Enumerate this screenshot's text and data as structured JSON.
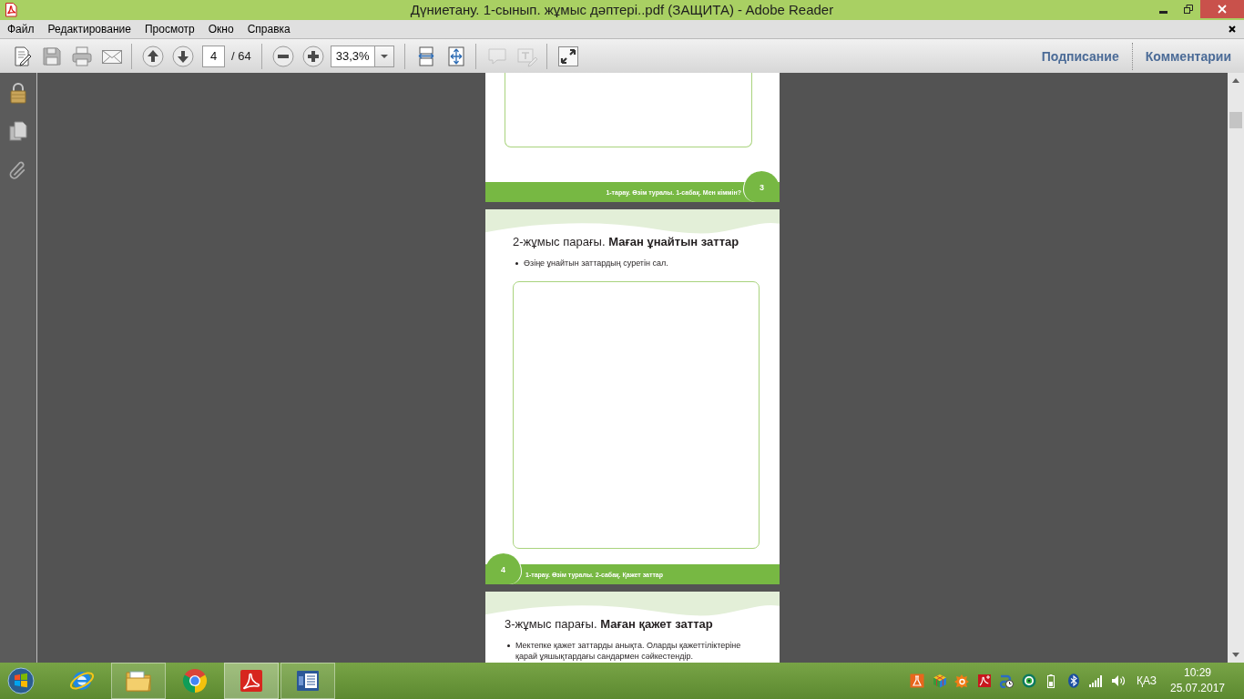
{
  "window": {
    "title": "Дүниетану. 1-сынып. жұмыс дәптері..pdf (ЗАЩИТА) - Adobe Reader"
  },
  "menu": [
    {
      "label": "Файл"
    },
    {
      "label": "Редактирование"
    },
    {
      "label": "Просмотр"
    },
    {
      "label": "Окно"
    },
    {
      "label": "Справка"
    }
  ],
  "toolbar": {
    "file_tools": [
      {
        "kind": "edit",
        "disabled": false
      },
      {
        "kind": "save",
        "disabled": false
      },
      {
        "kind": "print",
        "disabled": false
      },
      {
        "kind": "mail",
        "disabled": false
      }
    ],
    "navigation": {
      "tools": [
        {
          "kind": "previous",
          "disabled": false
        },
        {
          "kind": "next",
          "disabled": false
        }
      ],
      "page_field": {
        "value": "4"
      },
      "page_count": "/ 64"
    },
    "zoom": {
      "tools": [
        {
          "kind": "zoom_out",
          "disabled": false
        },
        {
          "kind": "zoom_in",
          "disabled": false
        }
      ],
      "field": {
        "value": "33,3%"
      }
    },
    "view_tools": [
      {
        "kind": "scroll_mode",
        "disabled": false
      },
      {
        "kind": "fit_page",
        "disabled": false
      }
    ],
    "annotation_tools": [
      {
        "kind": "comment",
        "disabled": true
      },
      {
        "kind": "text",
        "disabled": true
      }
    ],
    "display_tools": [
      {
        "kind": "full_screen",
        "disabled": false
      }
    ],
    "panels": [
      {
        "label": "Подписание"
      },
      {
        "label": "Комментарии"
      }
    ]
  },
  "document": {
    "pages": [
      {
        "kind": "recto",
        "frame": true,
        "footer": {
          "text": "1-тарау. Өзім туралы. 1-сабақ. Мен кіммін?",
          "number": "3"
        }
      },
      {
        "kind": "verso",
        "worksheet": "2-жұмыс парағы. **Маған ұнайтын заттар**",
        "bullets": [
          "Өзіңе ұнайтын заттардың суретін сал."
        ],
        "frame": true,
        "footer": {
          "text": "1-тарау. Өзім туралы. 2-сабақ. Қажет заттар",
          "number": "4"
        }
      },
      {
        "kind": "recto",
        "worksheet": "3-жұмыс парағы. **Маған қажет заттар**",
        "bullets": [
          "Мектепке қажет заттарды анықта. Оларды қажеттіліктеріне қарай ұяшықтардағы сандармен сәйкестендір."
        ]
      }
    ]
  },
  "taskbar": {
    "apps": [
      {
        "kind": "browser_e",
        "running": false,
        "selected": false
      },
      {
        "kind": "files",
        "running": true,
        "selected": false
      },
      {
        "kind": "browser_circle",
        "running": false,
        "selected": false
      },
      {
        "kind": "pdf_reader",
        "running": true,
        "selected": true
      },
      {
        "kind": "word_processor",
        "running": true,
        "selected": false
      }
    ],
    "language": "ҚАЗ",
    "time": "10:29",
    "date": "25.07.2017"
  }
}
